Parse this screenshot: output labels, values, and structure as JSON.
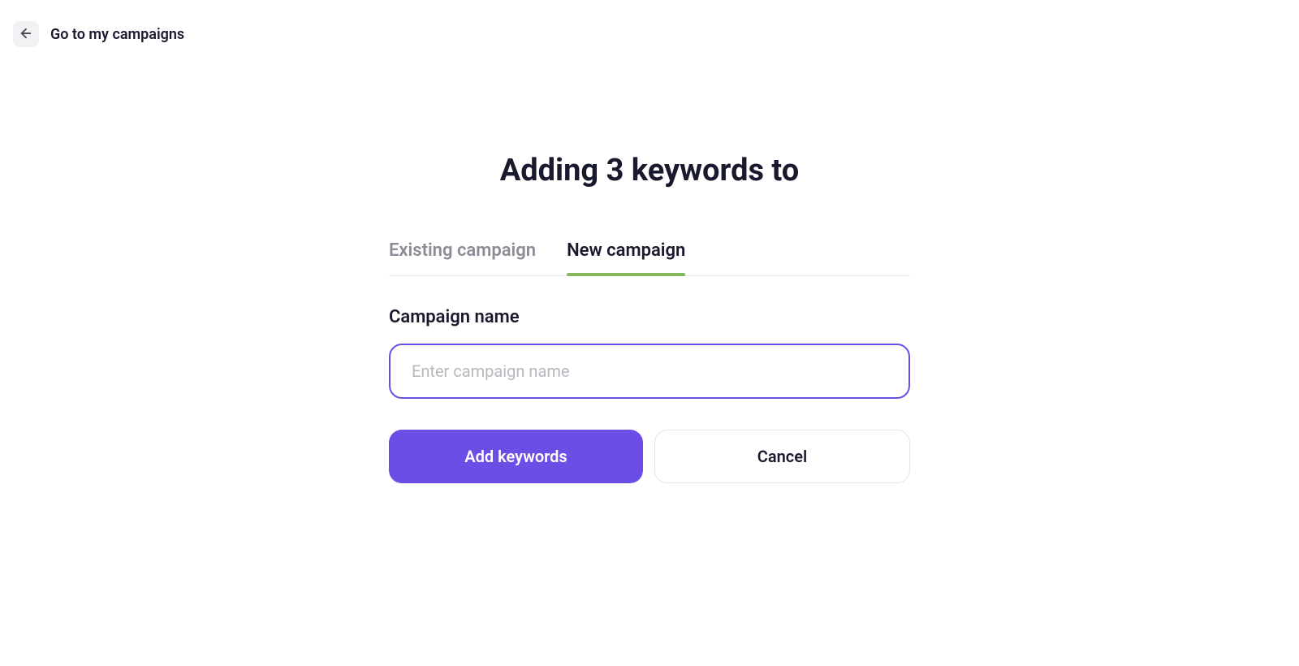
{
  "header": {
    "back_label": "Go to my campaigns"
  },
  "main": {
    "title": "Adding 3 keywords to",
    "tabs": [
      {
        "label": "Existing campaign",
        "active": false
      },
      {
        "label": "New campaign",
        "active": true
      }
    ],
    "form": {
      "field_label": "Campaign name",
      "input_value": "",
      "input_placeholder": "Enter campaign name"
    },
    "actions": {
      "primary_label": "Add keywords",
      "secondary_label": "Cancel"
    }
  },
  "colors": {
    "accent": "#6c4de6",
    "tab_indicator": "#82b75e",
    "text_primary": "#1a1a2e",
    "text_muted": "#8c8c96",
    "placeholder": "#b8b8bf"
  }
}
